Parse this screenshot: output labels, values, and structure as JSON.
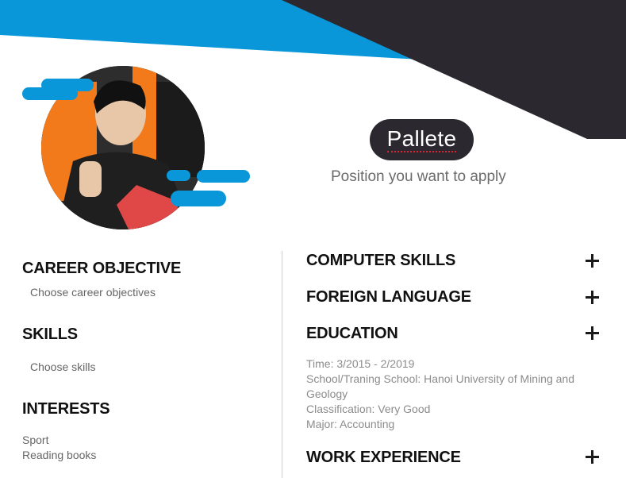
{
  "profile": {
    "name": "Pallete",
    "position_placeholder": "Position you want to apply"
  },
  "left": {
    "career_objective": {
      "title": "CAREER OBJECTIVE",
      "placeholder": "Choose career objectives"
    },
    "skills": {
      "title": "SKILLS",
      "placeholder": "Choose skills"
    },
    "interests": {
      "title": "INTERESTS",
      "items": [
        "Sport",
        "Reading books"
      ]
    }
  },
  "right": {
    "computer_skills": {
      "title": "COMPUTER SKILLS"
    },
    "foreign_language": {
      "title": "FOREIGN LANGUAGE"
    },
    "education": {
      "title": "EDUCATION",
      "lines": [
        "Time: 3/2015 - 2/2019",
        "School/Traning School: Hanoi University of Mining and Geology",
        "Classification: Very Good",
        "Major: Accounting"
      ]
    },
    "work_experience": {
      "title": "WORK EXPERIENCE"
    }
  },
  "icons": {
    "add": "plus-icon"
  },
  "colors": {
    "accent_blue": "#0a97d9",
    "dark": "#2b2830",
    "photo_orange": "#f27a1a"
  }
}
